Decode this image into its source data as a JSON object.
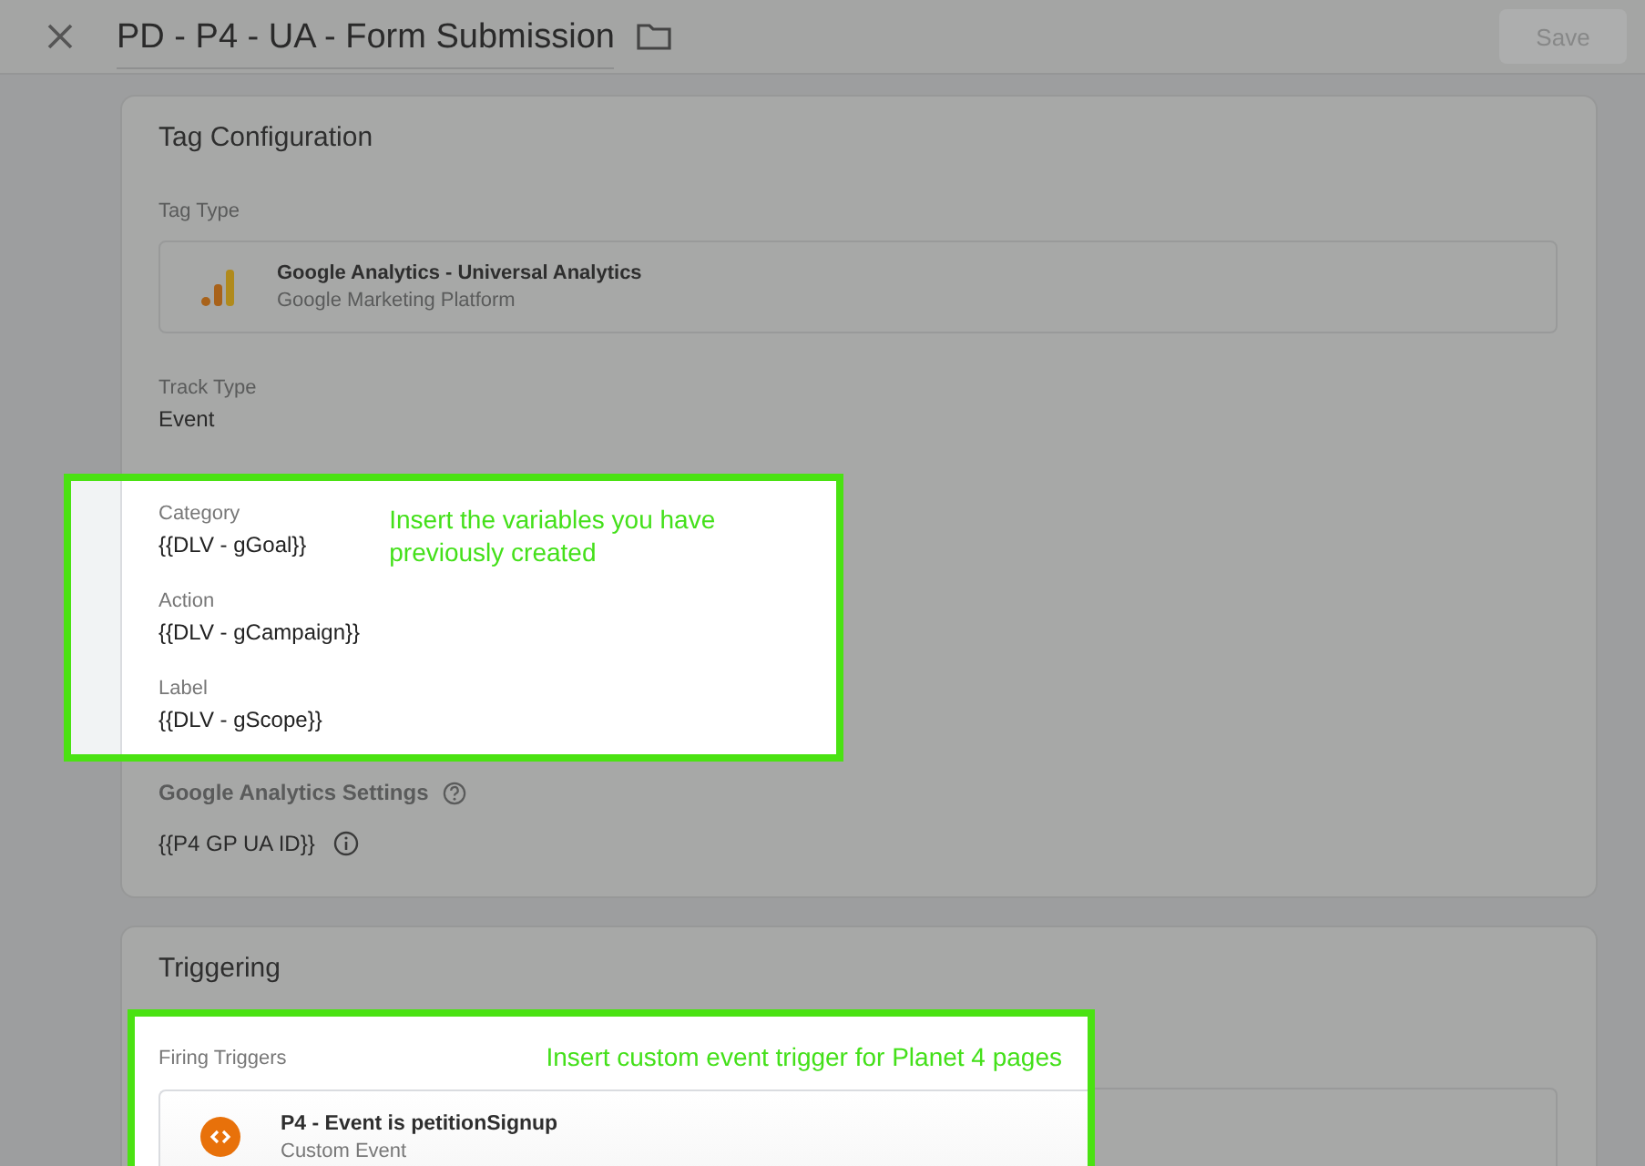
{
  "header": {
    "title": "PD - P4 - UA - Form Submission",
    "save_label": "Save"
  },
  "tag_configuration": {
    "title": "Tag Configuration",
    "tag_type_label": "Tag Type",
    "tag_type": {
      "name": "Google Analytics - Universal Analytics",
      "vendor": "Google Marketing Platform"
    },
    "track_type_label": "Track Type",
    "track_type": "Event",
    "highlighted_fields": [
      {
        "label": "Category",
        "value": "{{DLV - gGoal}}"
      },
      {
        "label": "Action",
        "value": "{{DLV - gCampaign}}"
      },
      {
        "label": "Label",
        "value": "{{DLV - gScope}}"
      }
    ],
    "note": "Insert the variables you have previously created",
    "settings_label": "Google Analytics Settings",
    "settings_value": "{{P4 GP UA ID}}"
  },
  "triggering": {
    "title": "Triggering",
    "firing_triggers_label": "Firing Triggers",
    "note": "Insert custom event trigger for Planet 4 pages",
    "trigger": {
      "name": "P4 - Event is petitionSignup",
      "type": "Custom Event"
    }
  }
}
